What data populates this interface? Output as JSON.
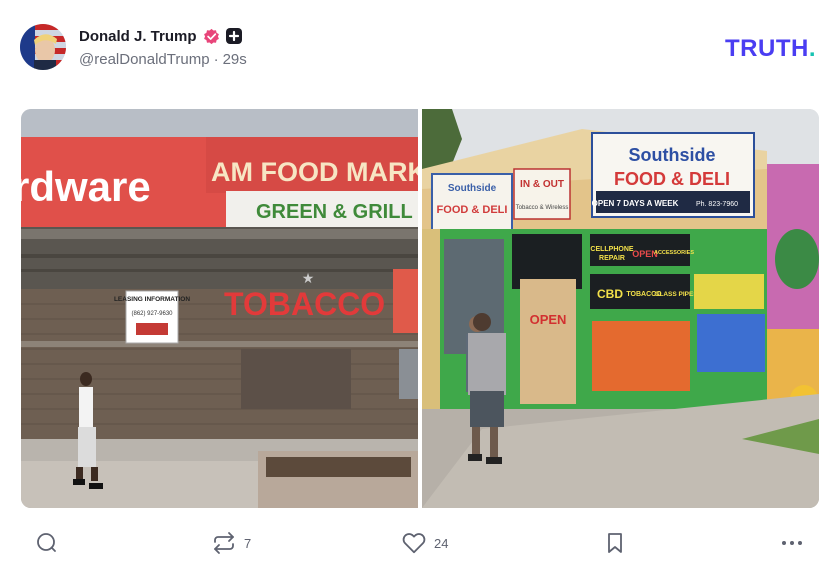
{
  "post": {
    "author_name": "Donald J. Trump",
    "handle": "@realDonaldTrump",
    "separator": "·",
    "time_ago": "29s"
  },
  "brand": {
    "word": "TRUTH",
    "dot": "."
  },
  "photos": {
    "left": {
      "sign_hardware": "rdware",
      "sign_market": "AM FOOD MARKET",
      "sign_green": "GREEN & GRILL",
      "leasing_title": "LEASING INFORMATION",
      "leasing_phone": "(862) 927-9630",
      "tobacco": "TOBACCO"
    },
    "right": {
      "sign_name": "Southside",
      "sign_food": "FOOD & DELI",
      "sign_hours": "OPEN 7 DAYS A WEEK",
      "sign_phone": "Ph. 823-7960",
      "small_sign_1": "Southside",
      "small_sign_2": "FOOD & DELI",
      "inout_1": "IN & OUT",
      "inout_2": "Tobacco & Wireless",
      "cellphone": "CELLPHONE",
      "repair": "REPAIR",
      "open_neon": "OPEN",
      "accessories": "ACCESSORIES",
      "cbd": "CBD",
      "tobacco": "TOBACCO",
      "glass_pipes": "GLASS PIPES",
      "board_open": "OPEN"
    }
  },
  "actions": {
    "reply_count": "",
    "retruth_count": "7",
    "like_count": "24"
  },
  "colors": {
    "brand": "#4a3df2",
    "brand_dot": "#17c3b2",
    "verified": "#e8457a",
    "icon_gray": "#5e6270"
  },
  "icons": [
    "verified-badge-icon",
    "plus-badge-icon",
    "reply-icon",
    "retruth-icon",
    "like-icon",
    "bookmark-icon",
    "more-icon"
  ]
}
